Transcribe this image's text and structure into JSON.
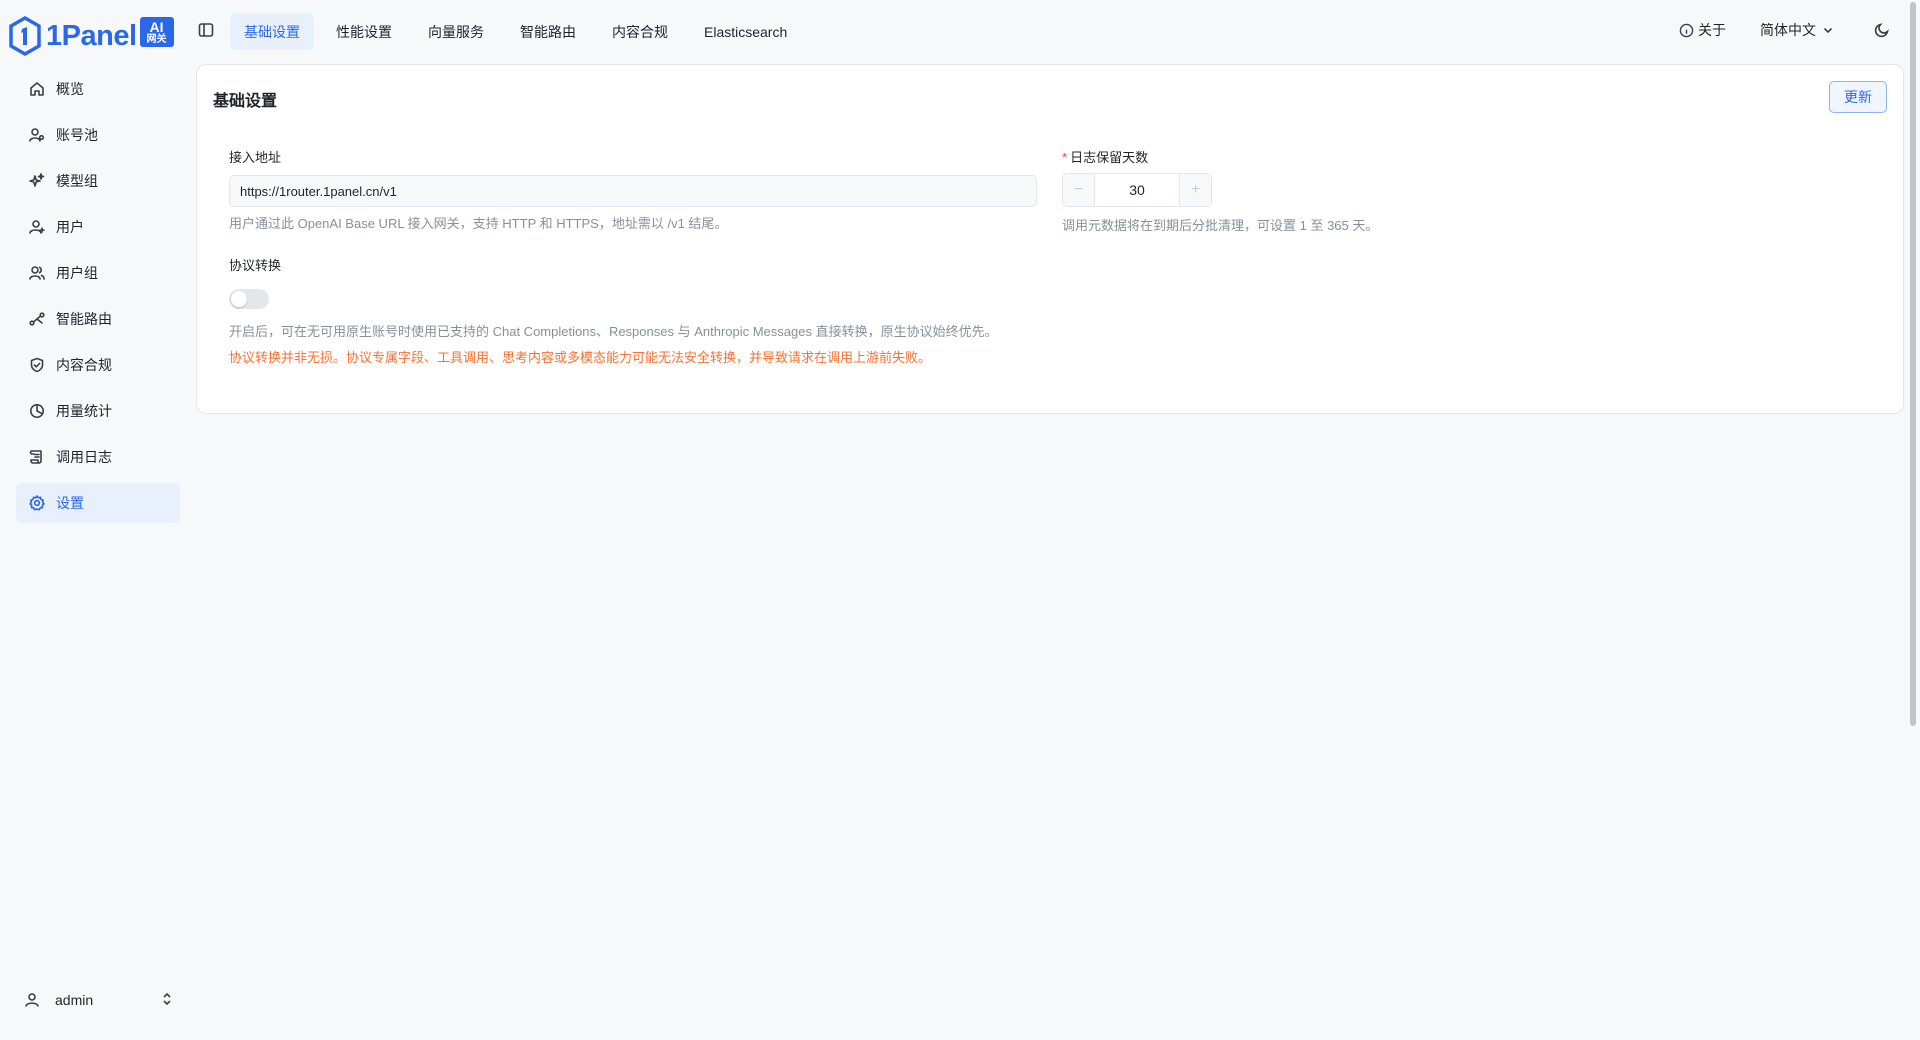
{
  "brand": {
    "name": "1Panel",
    "badge_line1": "AI",
    "badge_line2": "网关"
  },
  "sidebar": {
    "items": [
      {
        "label": "概览",
        "icon": "home-icon"
      },
      {
        "label": "账号池",
        "icon": "account-pool-icon"
      },
      {
        "label": "模型组",
        "icon": "sparkles-icon"
      },
      {
        "label": "用户",
        "icon": "user-plus-icon"
      },
      {
        "label": "用户组",
        "icon": "users-icon"
      },
      {
        "label": "智能路由",
        "icon": "route-icon"
      },
      {
        "label": "内容合规",
        "icon": "shield-check-icon"
      },
      {
        "label": "用量统计",
        "icon": "pie-chart-icon"
      },
      {
        "label": "调用日志",
        "icon": "scroll-icon"
      },
      {
        "label": "设置",
        "icon": "gear-icon",
        "active": true
      }
    ],
    "user": {
      "name": "admin"
    }
  },
  "tabs": [
    "基础设置",
    "性能设置",
    "向量服务",
    "智能路由",
    "内容合规",
    "Elasticsearch"
  ],
  "active_tab": "基础设置",
  "header_right": {
    "about": "关于",
    "language": "简体中文"
  },
  "card": {
    "title": "基础设置",
    "update_button": "更新",
    "endpoint": {
      "label": "接入地址",
      "value": "https://1router.1panel.cn/v1",
      "help": "用户通过此 OpenAI Base URL 接入网关，支持 HTTP 和 HTTPS，地址需以 /v1 结尾。"
    },
    "log_retention": {
      "required_mark": "*",
      "label": "日志保留天数",
      "value": "30",
      "minus": "−",
      "plus": "+",
      "help": "调用元数据将在到期后分批清理，可设置 1 至 365 天。"
    },
    "protocol": {
      "label": "协议转换",
      "enabled": false,
      "help": "开启后，可在无可用原生账号时使用已支持的 Chat Completions、Responses 与 Anthropic Messages 直接转换，原生协议始终优先。",
      "warning": "协议转换并非无损。协议专属字段、工具调用、思考内容或多模态能力可能无法安全转换，并导致请求在调用上游前失败。"
    }
  },
  "colors": {
    "accent": "#2b68e8",
    "warning": "#f77234",
    "muted": "#86909c"
  }
}
